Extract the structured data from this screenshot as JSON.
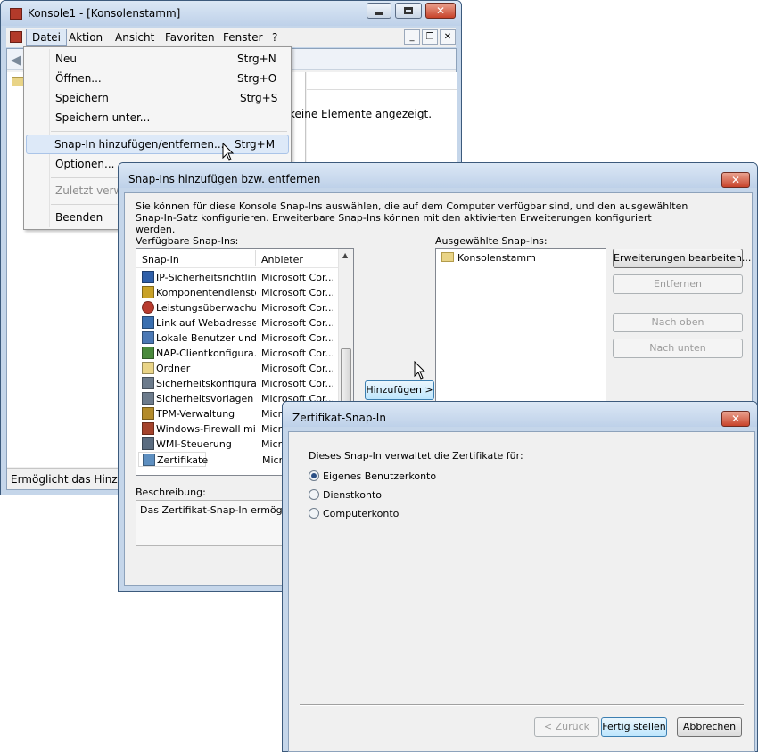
{
  "console": {
    "title": "Konsole1 - [Konsolenstamm]",
    "menu": [
      "Datei",
      "Aktion",
      "Ansicht",
      "Favoriten",
      "Fenster",
      "?"
    ],
    "empty_text": "keine Elemente angezeigt.",
    "status": "Ermöglicht das Hinzufügen"
  },
  "file_menu": {
    "items": [
      {
        "label": "Neu",
        "shortcut": "Strg+N"
      },
      {
        "label": "Öffnen...",
        "shortcut": "Strg+O"
      },
      {
        "label": "Speichern",
        "shortcut": "Strg+S"
      },
      {
        "label": "Speichern unter...",
        "shortcut": ""
      },
      {
        "label": "Snap-In hinzufügen/entfernen...",
        "shortcut": "Strg+M"
      },
      {
        "label": "Optionen...",
        "shortcut": ""
      },
      {
        "label": "Zuletzt verwe",
        "shortcut": ""
      },
      {
        "label": "Beenden",
        "shortcut": ""
      }
    ]
  },
  "snapins_dialog": {
    "title": "Snap-Ins hinzufügen bzw. entfernen",
    "intro": "Sie können für diese Konsole Snap-Ins auswählen, die auf dem Computer verfügbar sind, und den ausgewählten Snap-In-Satz konfigurieren. Erweiterbare Snap-Ins können mit den aktivierten Erweiterungen konfiguriert werden.",
    "available_label": "Verfügbare Snap-Ins:",
    "selected_label": "Ausgewählte Snap-Ins:",
    "col_snapin": "Snap-In",
    "col_provider": "Anbieter",
    "available": [
      {
        "name": "IP-Sicherheitsrichtlin...",
        "provider": "Microsoft Cor...",
        "icon": "ipsec-policy-icon"
      },
      {
        "name": "Komponentendienste",
        "provider": "Microsoft Cor...",
        "icon": "component-services-icon"
      },
      {
        "name": "Leistungsüberwachung",
        "provider": "Microsoft Cor...",
        "icon": "performance-monitor-icon"
      },
      {
        "name": "Link auf Webadresse",
        "provider": "Microsoft Cor...",
        "icon": "web-link-icon"
      },
      {
        "name": "Lokale Benutzer und...",
        "provider": "Microsoft Cor...",
        "icon": "local-users-icon"
      },
      {
        "name": "NAP-Clientkonfigura...",
        "provider": "Microsoft Cor...",
        "icon": "nap-client-icon"
      },
      {
        "name": "Ordner",
        "provider": "Microsoft Cor...",
        "icon": "folder-icon"
      },
      {
        "name": "Sicherheitskonfigura...",
        "provider": "Microsoft Cor...",
        "icon": "security-config-icon"
      },
      {
        "name": "Sicherheitsvorlagen",
        "provider": "Microsoft Cor...",
        "icon": "security-templates-icon"
      },
      {
        "name": "TPM-Verwaltung",
        "provider": "Micro",
        "icon": "tpm-icon"
      },
      {
        "name": "Windows-Firewall mi...",
        "provider": "Micro",
        "icon": "firewall-icon"
      },
      {
        "name": "WMI-Steuerung",
        "provider": "Micro",
        "icon": "wmi-icon"
      },
      {
        "name": "Zertifikate",
        "provider": "Micro",
        "icon": "certificate-icon"
      }
    ],
    "selected": [
      {
        "name": "Konsolenstamm",
        "icon": "folder-icon"
      }
    ],
    "add_button": "Hinzufügen >",
    "edit_extensions": "Erweiterungen bearbeiten...",
    "remove": "Entfernen",
    "move_up": "Nach oben",
    "move_down": "Nach unten",
    "description_label": "Beschreibung:",
    "description": "Das Zertifikat-Snap-In ermöglicht"
  },
  "cert_dialog": {
    "title": "Zertifikat-Snap-In",
    "prompt": "Dieses Snap-In verwaltet die Zertifikate für:",
    "options": [
      {
        "label": "Eigenes Benutzerkonto",
        "selected": true
      },
      {
        "label": "Dienstkonto",
        "selected": false
      },
      {
        "label": "Computerkonto",
        "selected": false
      }
    ],
    "back": "< Zurück",
    "finish": "Fertig stellen",
    "cancel": "Abbrechen"
  }
}
